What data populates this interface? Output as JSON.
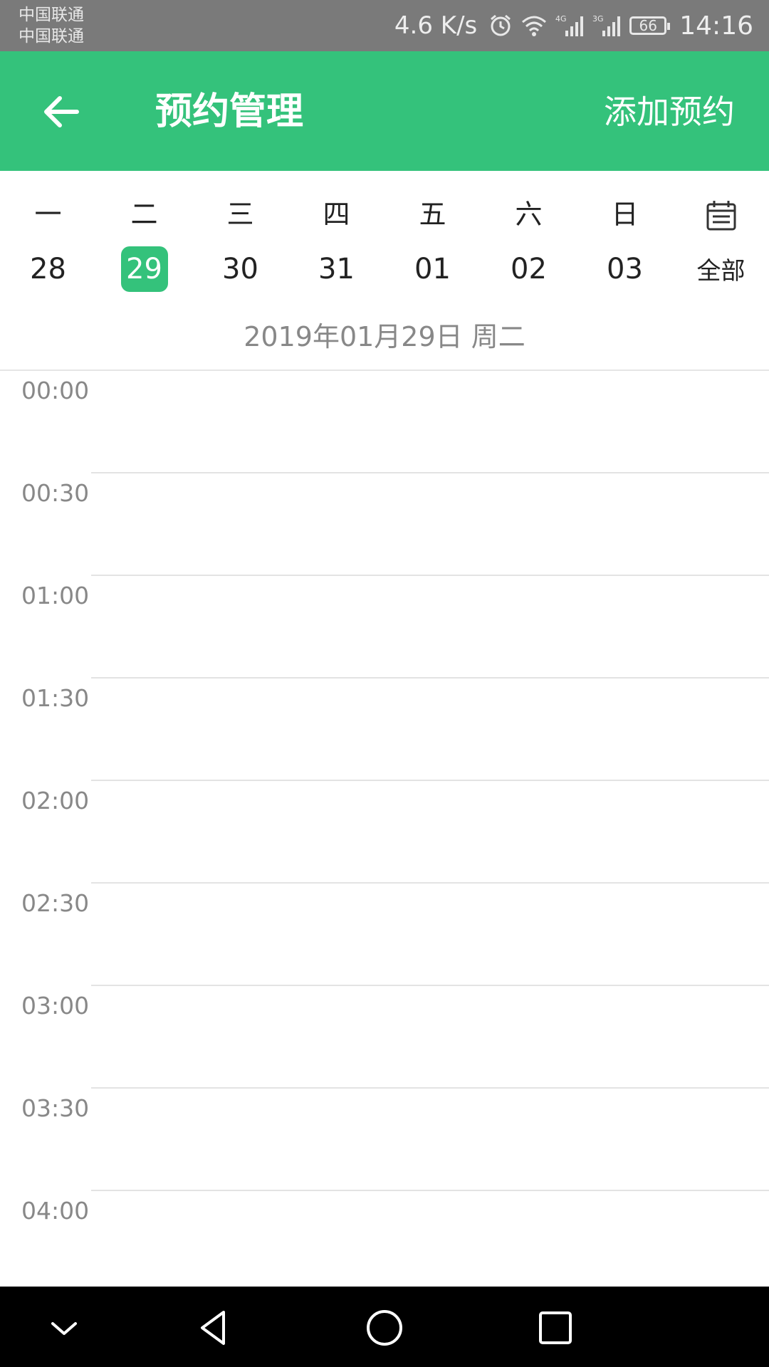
{
  "status_bar": {
    "carriers": [
      "中国联通",
      "中国联通"
    ],
    "speed": "4.6 K/s",
    "battery": "66",
    "time": "14:16",
    "icons": [
      "alarm-icon",
      "wifi-icon",
      "signal-4g-icon",
      "signal-3g-icon",
      "battery-icon"
    ]
  },
  "header": {
    "title": "预约管理",
    "add_label": "添加预约",
    "background": "#34c27b"
  },
  "week": {
    "days": [
      {
        "weekday": "一",
        "date": "28"
      },
      {
        "weekday": "二",
        "date": "29",
        "selected": true
      },
      {
        "weekday": "三",
        "date": "30"
      },
      {
        "weekday": "四",
        "date": "31"
      },
      {
        "weekday": "五",
        "date": "01"
      },
      {
        "weekday": "六",
        "date": "02"
      },
      {
        "weekday": "日",
        "date": "03"
      }
    ],
    "all_label": "全部"
  },
  "full_date": "2019年01月29日 周二",
  "timeline": {
    "slots": [
      "00:00",
      "00:30",
      "01:00",
      "01:30",
      "02:00",
      "02:30",
      "03:00",
      "03:30",
      "04:00"
    ]
  },
  "nav": [
    "collapse-icon",
    "back-triangle-icon",
    "home-circle-icon",
    "recents-square-icon"
  ]
}
